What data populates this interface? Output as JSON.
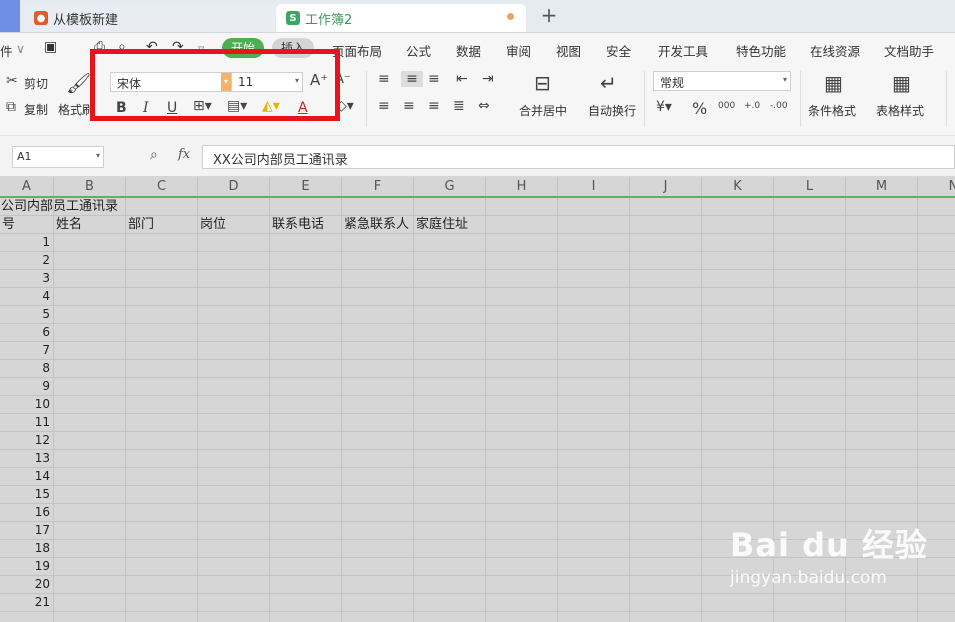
{
  "tabs": [
    {
      "label": "从模板新建",
      "icon": "flame-icon",
      "color": "#e05a2b"
    },
    {
      "label": "工作簿2",
      "icon": "sheet-icon",
      "color": "#3aa863",
      "modified": true
    }
  ],
  "new_tab_label": "+",
  "menu": {
    "partial_file": "件",
    "start": "开始",
    "insert": "插入",
    "items": [
      "页面布局",
      "公式",
      "数据",
      "审阅",
      "视图",
      "安全",
      "开发工具",
      "特色功能",
      "在线资源",
      "文档助手"
    ]
  },
  "ribbon": {
    "cut": "剪切",
    "copy": "复制",
    "format_painter": "格式刷",
    "font_name": "宋体",
    "font_size": "11",
    "merge_center": "合并居中",
    "wrap_text": "自动换行",
    "number_format": "常规",
    "cond_format": "条件格式",
    "table_style": "表格样式",
    "bold": "B",
    "italic": "I",
    "underline": "U",
    "font_color": "A",
    "percent": "%",
    "thousands": "000",
    "dec_inc": "+.0",
    "dec_dec": "-.00"
  },
  "formula_bar": {
    "cell_ref": "A1",
    "fx": "fx",
    "content": "XX公司内部员工通讯录"
  },
  "columns": [
    "A",
    "B",
    "C",
    "D",
    "E",
    "F",
    "G",
    "H",
    "I",
    "J",
    "K",
    "L",
    "M",
    "N"
  ],
  "sheet": {
    "title": "公司内部员工通讯录",
    "headers": [
      "号",
      "姓名",
      "部门",
      "岗位",
      "联系电话",
      "紧急联系人",
      "家庭住址"
    ],
    "row_numbers": [
      "1",
      "2",
      "3",
      "4",
      "5",
      "6",
      "7",
      "8",
      "9",
      "10",
      "11",
      "12",
      "13",
      "14",
      "15",
      "16",
      "17",
      "18",
      "19",
      "20",
      "21"
    ]
  },
  "watermark": {
    "brand": "Bai du 经验",
    "url": "jingyan.baidu.com"
  },
  "colors": {
    "highlight_box": "#e8141b",
    "start_tab": "#4caf50",
    "accent_green": "#3aa863"
  }
}
